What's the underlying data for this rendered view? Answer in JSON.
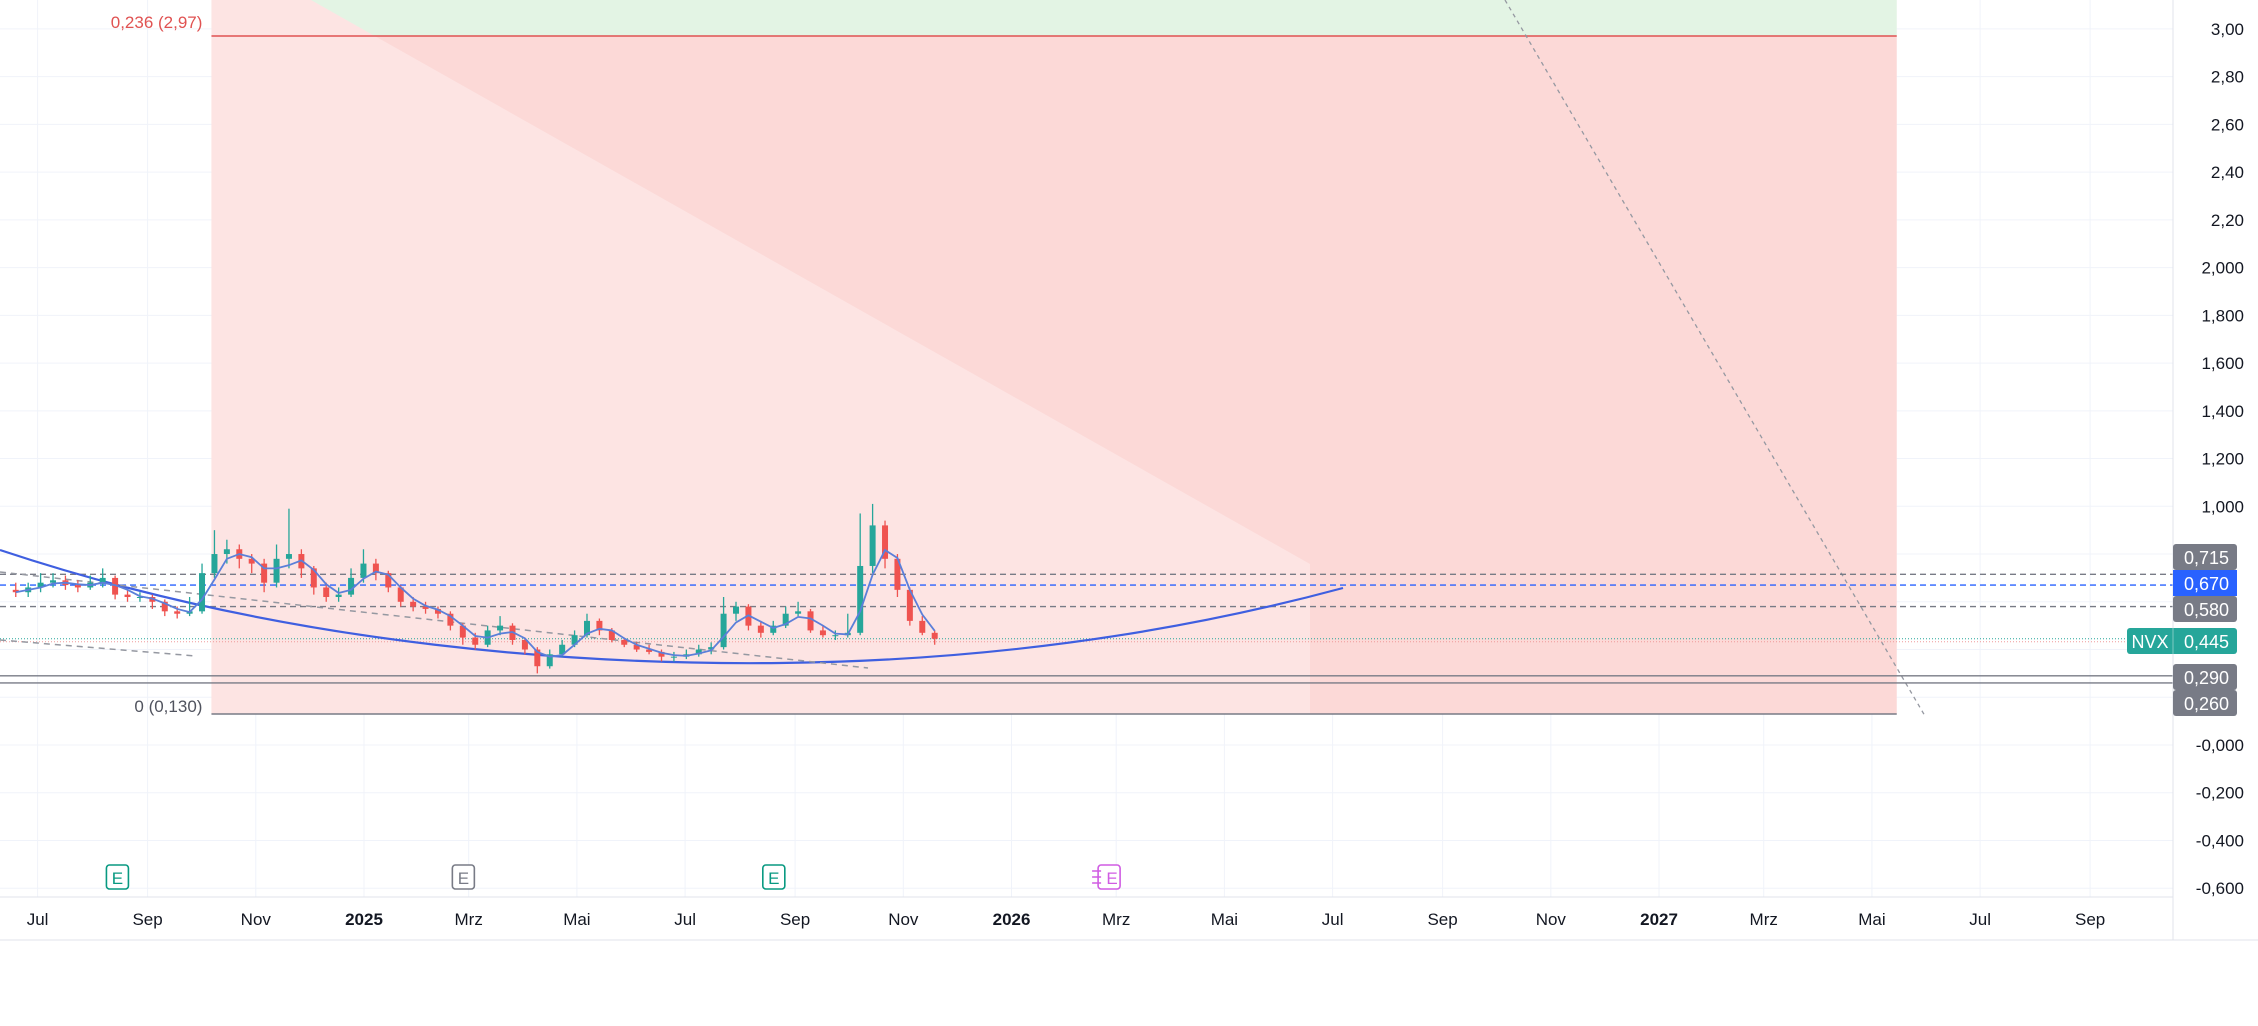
{
  "chart_data": {
    "type": "candlestick",
    "symbol": "NVX",
    "last_price": "0,445",
    "y_range": [
      -0.6,
      3.0
    ],
    "grid": true,
    "price_axis_labels": [
      "3,00",
      "2,80",
      "2,60",
      "2,40",
      "2,20",
      "2,000",
      "1,800",
      "1,600",
      "1,400",
      "1,200",
      "1,000",
      "-0,000",
      "-0,200",
      "-0,400",
      "-0,600"
    ],
    "price_axis_values": [
      3.0,
      2.8,
      2.6,
      2.4,
      2.2,
      2.0,
      1.8,
      1.6,
      1.4,
      1.2,
      1.0,
      0,
      -0.2,
      -0.4,
      -0.6
    ],
    "time_axis": [
      {
        "label": "Jul",
        "date": "2024-07-01",
        "bold": false
      },
      {
        "label": "Sep",
        "date": "2024-09-01",
        "bold": false
      },
      {
        "label": "Nov",
        "date": "2024-11-01",
        "bold": false
      },
      {
        "label": "2025",
        "date": "2025-01-01",
        "bold": true
      },
      {
        "label": "Mrz",
        "date": "2025-03-01",
        "bold": false
      },
      {
        "label": "Mai",
        "date": "2025-05-01",
        "bold": false
      },
      {
        "label": "Jul",
        "date": "2025-07-01",
        "bold": false
      },
      {
        "label": "Sep",
        "date": "2025-09-01",
        "bold": false
      },
      {
        "label": "Nov",
        "date": "2025-11-01",
        "bold": false
      },
      {
        "label": "2026",
        "date": "2026-01-01",
        "bold": true
      },
      {
        "label": "Mrz",
        "date": "2026-03-01",
        "bold": false
      },
      {
        "label": "Mai",
        "date": "2026-05-01",
        "bold": false
      },
      {
        "label": "Jul",
        "date": "2026-07-01",
        "bold": false
      },
      {
        "label": "Sep",
        "date": "2026-09-01",
        "bold": false
      },
      {
        "label": "Nov",
        "date": "2026-11-01",
        "bold": false
      },
      {
        "label": "2027",
        "date": "2027-01-01",
        "bold": true
      },
      {
        "label": "Mrz",
        "date": "2027-03-01",
        "bold": false
      },
      {
        "label": "Mai",
        "date": "2027-05-01",
        "bold": false
      },
      {
        "label": "Jul",
        "date": "2027-07-01",
        "bold": false
      },
      {
        "label": "Sep",
        "date": "2027-09-01",
        "bold": false
      }
    ],
    "candles_columns": [
      "week",
      "open",
      "high",
      "low",
      "close"
    ],
    "candles": [
      [
        "2024-06-17",
        0.65,
        0.68,
        0.62,
        0.64
      ],
      [
        "2024-06-24",
        0.64,
        0.68,
        0.62,
        0.66
      ],
      [
        "2024-07-01",
        0.66,
        0.72,
        0.64,
        0.68
      ],
      [
        "2024-07-08",
        0.68,
        0.72,
        0.66,
        0.69
      ],
      [
        "2024-07-15",
        0.69,
        0.71,
        0.65,
        0.67
      ],
      [
        "2024-07-22",
        0.67,
        0.69,
        0.64,
        0.66
      ],
      [
        "2024-07-29",
        0.66,
        0.71,
        0.65,
        0.68
      ],
      [
        "2024-08-05",
        0.68,
        0.74,
        0.66,
        0.7
      ],
      [
        "2024-08-12",
        0.7,
        0.71,
        0.61,
        0.63
      ],
      [
        "2024-08-19",
        0.63,
        0.65,
        0.6,
        0.62
      ],
      [
        "2024-08-26",
        0.62,
        0.64,
        0.6,
        0.62
      ],
      [
        "2024-09-02",
        0.62,
        0.63,
        0.57,
        0.6
      ],
      [
        "2024-09-09",
        0.6,
        0.61,
        0.54,
        0.56
      ],
      [
        "2024-09-16",
        0.56,
        0.58,
        0.53,
        0.55
      ],
      [
        "2024-09-23",
        0.55,
        0.62,
        0.54,
        0.56
      ],
      [
        "2024-09-30",
        0.56,
        0.76,
        0.55,
        0.72
      ],
      [
        "2024-10-07",
        0.72,
        0.9,
        0.7,
        0.8
      ],
      [
        "2024-10-14",
        0.8,
        0.86,
        0.76,
        0.82
      ],
      [
        "2024-10-21",
        0.82,
        0.84,
        0.74,
        0.78
      ],
      [
        "2024-10-28",
        0.78,
        0.8,
        0.72,
        0.76
      ],
      [
        "2024-11-04",
        0.76,
        0.78,
        0.64,
        0.68
      ],
      [
        "2024-11-11",
        0.68,
        0.84,
        0.66,
        0.78
      ],
      [
        "2024-11-18",
        0.78,
        0.99,
        0.74,
        0.8
      ],
      [
        "2024-11-25",
        0.8,
        0.82,
        0.7,
        0.74
      ],
      [
        "2024-12-02",
        0.74,
        0.75,
        0.63,
        0.66
      ],
      [
        "2024-12-09",
        0.66,
        0.68,
        0.6,
        0.62
      ],
      [
        "2024-12-16",
        0.62,
        0.66,
        0.6,
        0.63
      ],
      [
        "2024-12-23",
        0.63,
        0.74,
        0.62,
        0.7
      ],
      [
        "2024-12-30",
        0.7,
        0.82,
        0.68,
        0.76
      ],
      [
        "2025-01-06",
        0.76,
        0.78,
        0.69,
        0.72
      ],
      [
        "2025-01-13",
        0.72,
        0.73,
        0.64,
        0.66
      ],
      [
        "2025-01-20",
        0.66,
        0.67,
        0.58,
        0.6
      ],
      [
        "2025-01-27",
        0.6,
        0.62,
        0.56,
        0.58
      ],
      [
        "2025-02-03",
        0.58,
        0.6,
        0.55,
        0.57
      ],
      [
        "2025-02-10",
        0.57,
        0.58,
        0.53,
        0.55
      ],
      [
        "2025-02-17",
        0.55,
        0.56,
        0.48,
        0.5
      ],
      [
        "2025-02-24",
        0.5,
        0.51,
        0.42,
        0.45
      ],
      [
        "2025-03-03",
        0.45,
        0.47,
        0.4,
        0.42
      ],
      [
        "2025-03-10",
        0.42,
        0.5,
        0.41,
        0.48
      ],
      [
        "2025-03-17",
        0.48,
        0.54,
        0.46,
        0.5
      ],
      [
        "2025-03-24",
        0.5,
        0.51,
        0.42,
        0.44
      ],
      [
        "2025-03-31",
        0.44,
        0.45,
        0.38,
        0.4
      ],
      [
        "2025-04-07",
        0.4,
        0.41,
        0.3,
        0.33
      ],
      [
        "2025-04-14",
        0.33,
        0.4,
        0.32,
        0.38
      ],
      [
        "2025-04-21",
        0.38,
        0.44,
        0.37,
        0.42
      ],
      [
        "2025-04-28",
        0.42,
        0.48,
        0.41,
        0.46
      ],
      [
        "2025-05-05",
        0.46,
        0.55,
        0.45,
        0.52
      ],
      [
        "2025-05-12",
        0.52,
        0.53,
        0.46,
        0.48
      ],
      [
        "2025-05-19",
        0.48,
        0.49,
        0.43,
        0.44
      ],
      [
        "2025-05-26",
        0.44,
        0.45,
        0.41,
        0.42
      ],
      [
        "2025-06-02",
        0.42,
        0.43,
        0.39,
        0.4
      ],
      [
        "2025-06-09",
        0.4,
        0.42,
        0.38,
        0.39
      ],
      [
        "2025-06-16",
        0.39,
        0.4,
        0.35,
        0.37
      ],
      [
        "2025-06-23",
        0.37,
        0.39,
        0.35,
        0.37
      ],
      [
        "2025-06-30",
        0.37,
        0.4,
        0.36,
        0.38
      ],
      [
        "2025-07-07",
        0.38,
        0.42,
        0.37,
        0.4
      ],
      [
        "2025-07-14",
        0.4,
        0.43,
        0.38,
        0.41
      ],
      [
        "2025-07-21",
        0.41,
        0.62,
        0.4,
        0.55
      ],
      [
        "2025-07-28",
        0.55,
        0.6,
        0.52,
        0.58
      ],
      [
        "2025-08-04",
        0.58,
        0.59,
        0.48,
        0.5
      ],
      [
        "2025-08-11",
        0.5,
        0.52,
        0.45,
        0.47
      ],
      [
        "2025-08-18",
        0.47,
        0.52,
        0.46,
        0.5
      ],
      [
        "2025-08-25",
        0.5,
        0.58,
        0.49,
        0.55
      ],
      [
        "2025-09-01",
        0.55,
        0.6,
        0.54,
        0.56
      ],
      [
        "2025-09-08",
        0.56,
        0.57,
        0.47,
        0.48
      ],
      [
        "2025-09-15",
        0.48,
        0.5,
        0.45,
        0.46
      ],
      [
        "2025-09-22",
        0.46,
        0.48,
        0.44,
        0.46
      ],
      [
        "2025-09-29",
        0.46,
        0.55,
        0.45,
        0.47
      ],
      [
        "2025-10-06",
        0.47,
        0.97,
        0.46,
        0.75
      ],
      [
        "2025-10-13",
        0.75,
        1.01,
        0.72,
        0.92
      ],
      [
        "2025-10-20",
        0.92,
        0.94,
        0.74,
        0.78
      ],
      [
        "2025-10-27",
        0.78,
        0.8,
        0.62,
        0.65
      ],
      [
        "2025-11-03",
        0.65,
        0.66,
        0.5,
        0.52
      ],
      [
        "2025-11-10",
        0.52,
        0.54,
        0.46,
        0.47
      ],
      [
        "2025-11-17",
        0.47,
        0.48,
        0.42,
        0.445
      ]
    ],
    "colors": {
      "up": "#26a69a",
      "down": "#ef5350",
      "ma": "#5b7fd9",
      "curve": "#3f5fe0",
      "fib_red": "#fcd9d7",
      "fib_green": "#e3f4e4",
      "fib_line": "#e05252",
      "grid": "#f0f3fa"
    },
    "horizontal_levels": [
      {
        "value": 0.715,
        "label": "0,715",
        "style": "dashed",
        "color": "#787b86"
      },
      {
        "value": 0.67,
        "label": "0,670",
        "style": "dashed",
        "color": "#2962ff"
      },
      {
        "value": 0.58,
        "label": "0,580",
        "style": "dashed",
        "color": "#787b86"
      },
      {
        "value": 0.29,
        "label": "0,290",
        "style": "solid",
        "color": "#787b86"
      },
      {
        "value": 0.26,
        "label": "0,260",
        "style": "solid",
        "color": "#787b86"
      }
    ],
    "fib": {
      "start": "2024-10-07",
      "end": "2027-05-15",
      "levels": [
        {
          "value": 2.97,
          "label": "0,236 (2,97)",
          "color": "#e05252"
        },
        {
          "value": 0.13,
          "label": "0 (0,130)",
          "color": "#787b86"
        }
      ]
    },
    "earnings": [
      {
        "date": "2024-08-15",
        "label": "E",
        "color": "#089981"
      },
      {
        "date": "2025-02-26",
        "label": "E",
        "color": "#787b86"
      },
      {
        "date": "2025-08-20",
        "label": "E",
        "color": "#089981"
      },
      {
        "date": "2026-02-25",
        "label": "E",
        "color": "#d05ce3",
        "upcoming": true
      }
    ]
  }
}
